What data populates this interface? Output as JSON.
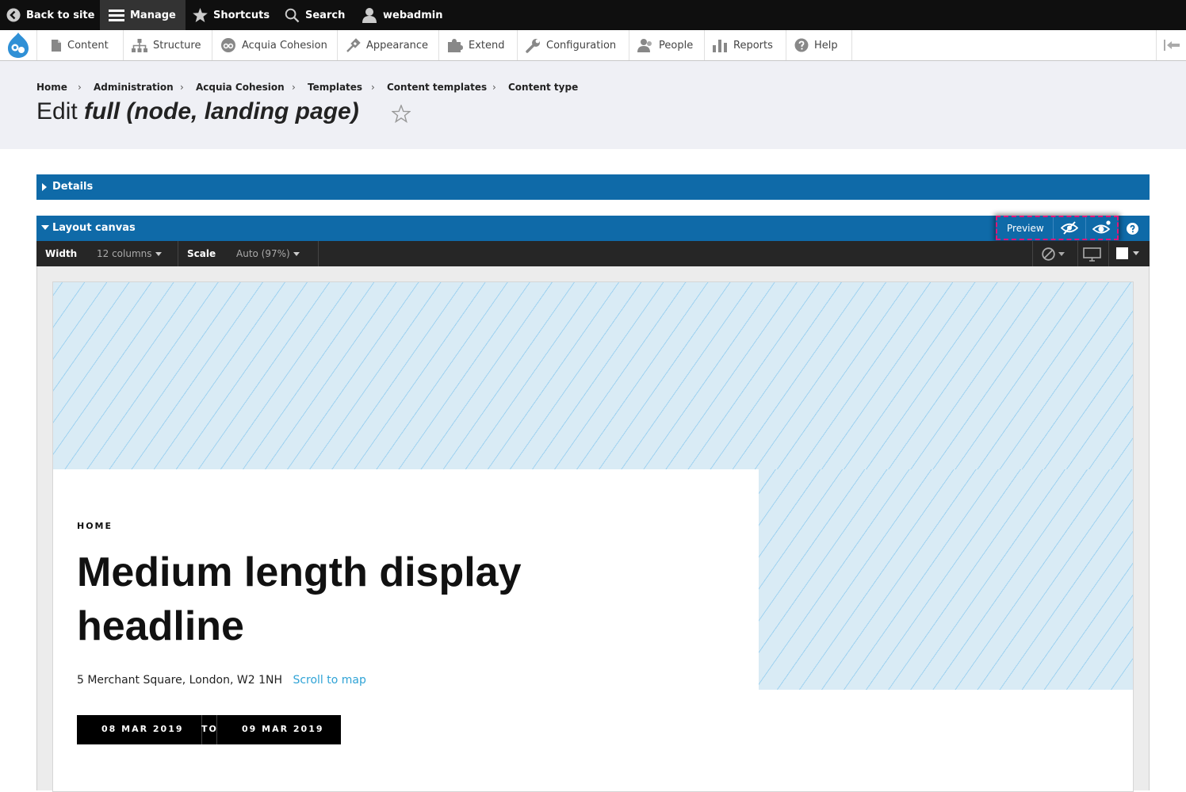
{
  "toolbar": {
    "back_to_site": "Back to site",
    "manage": "Manage",
    "shortcuts": "Shortcuts",
    "search": "Search",
    "user": "webadmin"
  },
  "tray": {
    "items": [
      {
        "label": "Content",
        "icon": "file-icon"
      },
      {
        "label": "Structure",
        "icon": "sitemap-icon"
      },
      {
        "label": "Acquia Cohesion",
        "icon": "cohesion-icon"
      },
      {
        "label": "Appearance",
        "icon": "paintbrush-icon"
      },
      {
        "label": "Extend",
        "icon": "puzzle-icon"
      },
      {
        "label": "Configuration",
        "icon": "wrench-icon"
      },
      {
        "label": "People",
        "icon": "people-icon"
      },
      {
        "label": "Reports",
        "icon": "bar-chart-icon"
      },
      {
        "label": "Help",
        "icon": "help-icon"
      }
    ]
  },
  "breadcrumb": [
    "Home",
    "Administration",
    "Acquia Cohesion",
    "Templates",
    "Content templates",
    "Content type"
  ],
  "title": {
    "prefix": "Edit",
    "emphasis": "full (node, landing page)"
  },
  "details": {
    "label": "Details"
  },
  "layout_canvas": {
    "label": "Layout canvas",
    "preview_label": "Preview"
  },
  "canvas_toolbar": {
    "width_label": "Width",
    "width_value": "12 columns",
    "scale_label": "Scale",
    "scale_value": "Auto (97%)"
  },
  "content": {
    "eyebrow": "HOME",
    "headline_line1": "Medium length display",
    "headline_line2": "headline",
    "address": "5 Merchant Square, London, W2 1NH",
    "scroll_link": "Scroll to map",
    "date_start": "08 MAR 2019",
    "date_to": "TO",
    "date_end": "09 MAR 2019"
  },
  "colors": {
    "toolbar_bg": "#0f0f0f",
    "accent_blue": "#0f6aa8",
    "preview_highlight": "#e0157a",
    "link": "#2fa3d6"
  }
}
